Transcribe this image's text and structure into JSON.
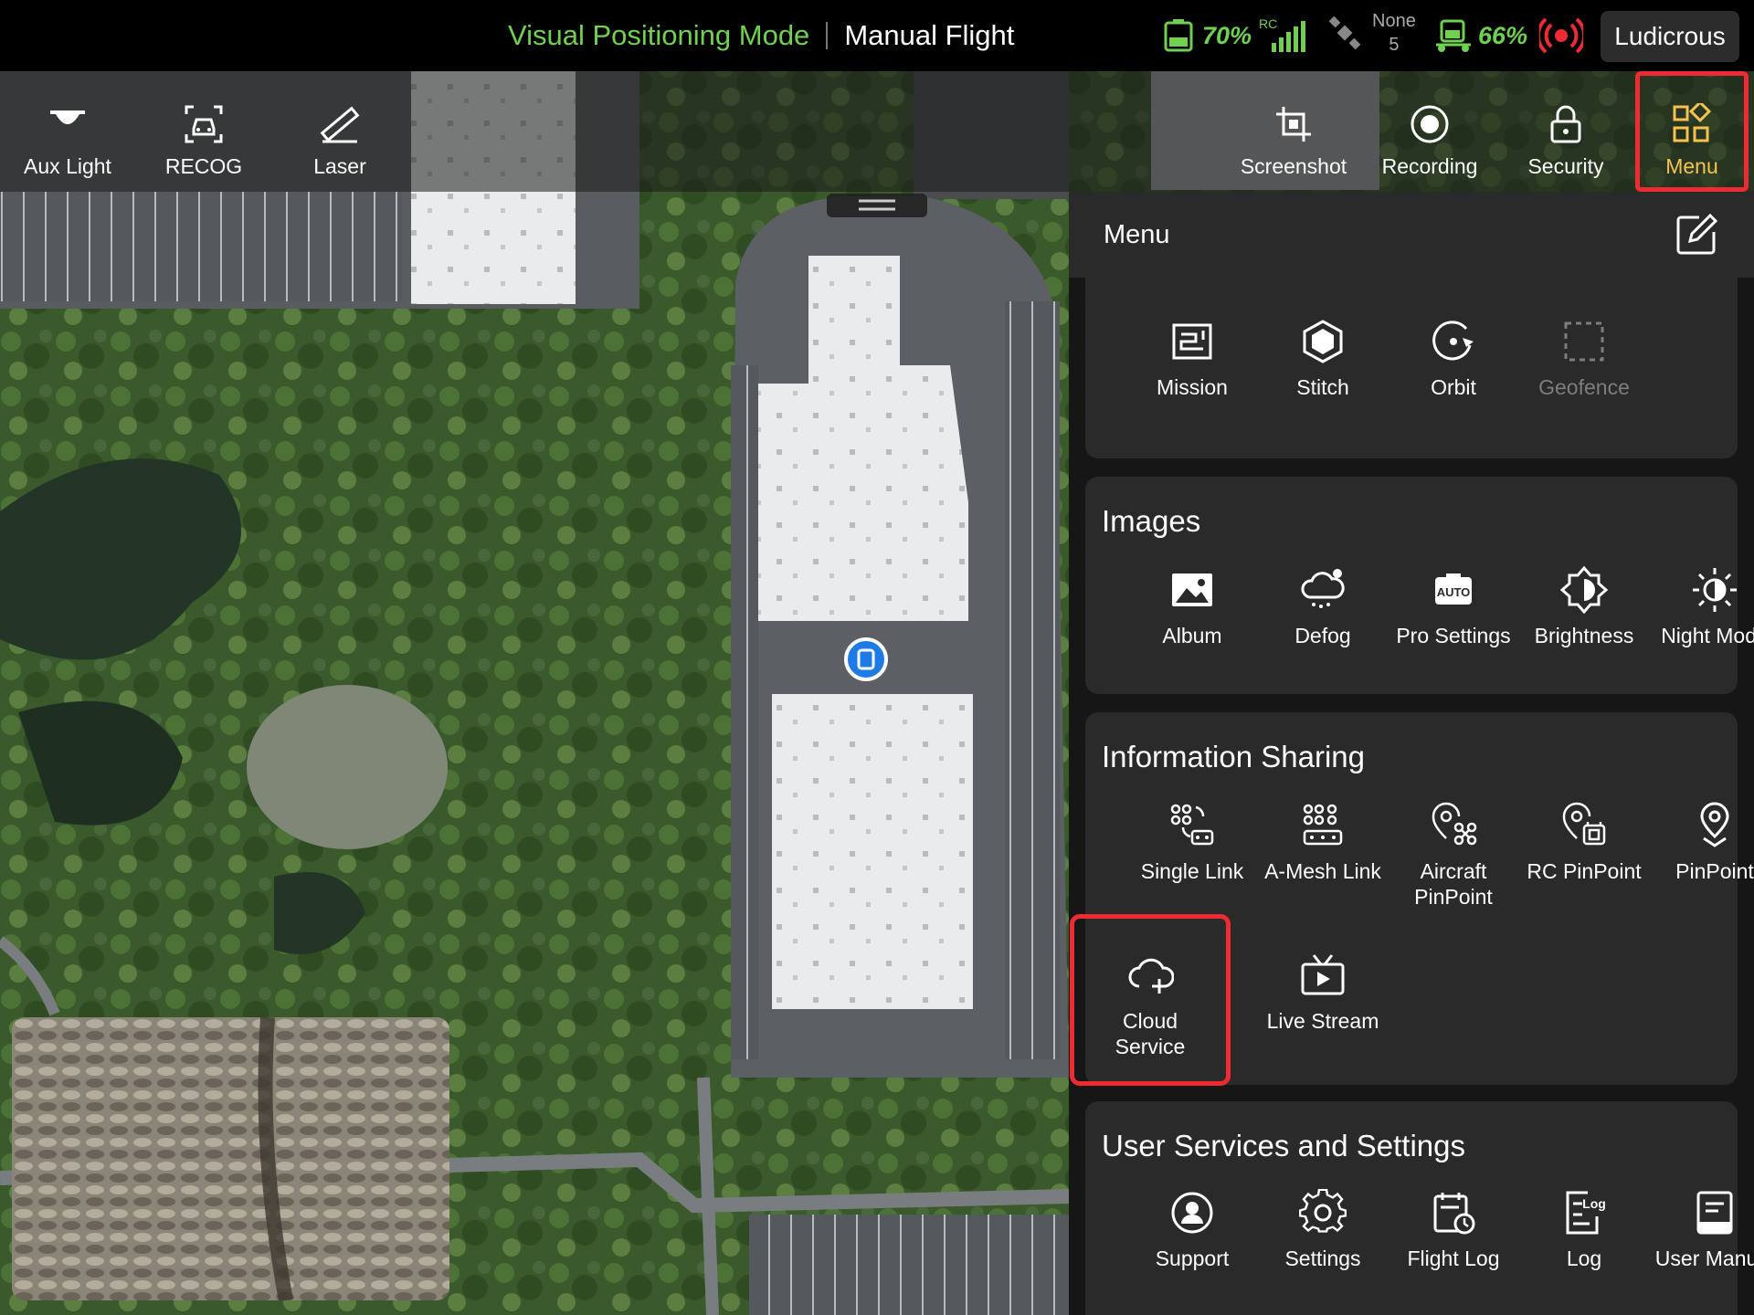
{
  "status_bar": {
    "positioning_mode": "Visual Positioning Mode",
    "flight_mode": "Manual Flight",
    "rc_battery_pct": "70%",
    "rc_label": "RC",
    "gnss_status": "None",
    "satellite_count": "5",
    "aircraft_battery_pct": "66%",
    "speed_mode": "Ludicrous",
    "colors": {
      "accent_green": "#6fd14f",
      "alert_red": "#ee2b33",
      "menu_active": "#f5c24b"
    }
  },
  "toolbar": {
    "left": [
      {
        "label": "Aux Light",
        "icon": "aux-light-icon"
      },
      {
        "label": "RECOG",
        "icon": "recog-car-icon"
      },
      {
        "label": "Laser",
        "icon": "laser-ruler-icon"
      }
    ],
    "right": [
      {
        "label": "Screenshot",
        "icon": "screenshot-crop-icon"
      },
      {
        "label": "Recording",
        "icon": "record-icon"
      },
      {
        "label": "Security",
        "icon": "lock-icon"
      },
      {
        "label": "Menu",
        "icon": "grid-menu-icon",
        "active": true
      }
    ]
  },
  "panel": {
    "title": "Menu",
    "edit_icon": "edit-icon",
    "sections": [
      {
        "title": "",
        "items": [
          {
            "label": "Mission",
            "icon": "mission-icon"
          },
          {
            "label": "Stitch",
            "icon": "stitch-icon"
          },
          {
            "label": "Orbit",
            "icon": "orbit-icon"
          },
          {
            "label": "Geofence",
            "icon": "geofence-icon",
            "disabled": true
          }
        ]
      },
      {
        "title": "Images",
        "items": [
          {
            "label": "Album",
            "icon": "album-icon"
          },
          {
            "label": "Defog",
            "icon": "defog-icon"
          },
          {
            "label": "Pro Settings",
            "icon": "auto-icon"
          },
          {
            "label": "Brightness",
            "icon": "brightness-icon"
          },
          {
            "label": "Night Mode",
            "icon": "night-mode-icon"
          }
        ]
      },
      {
        "title": "Information Sharing",
        "items": [
          {
            "label": "Single Link",
            "icon": "single-link-icon"
          },
          {
            "label": "A-Mesh Link",
            "icon": "mesh-link-icon"
          },
          {
            "label": "Aircraft\nPinPoint",
            "label_line1": "Aircraft",
            "label_line2": "PinPoint",
            "icon": "aircraft-pinpoint-icon"
          },
          {
            "label": "RC PinPoint",
            "icon": "rc-pinpoint-icon"
          },
          {
            "label": "PinPoint",
            "icon": "pinpoint-icon"
          },
          {
            "label_line1": "Cloud",
            "label_line2": "Service",
            "icon": "cloud-service-icon",
            "highlighted": true
          },
          {
            "label": "Live Stream",
            "icon": "live-stream-icon"
          }
        ]
      },
      {
        "title": "User Services and Settings",
        "items": [
          {
            "label": "Support",
            "icon": "support-icon"
          },
          {
            "label": "Settings",
            "icon": "settings-gear-icon"
          },
          {
            "label": "Flight Log",
            "icon": "flight-log-icon"
          },
          {
            "label": "Log",
            "icon": "log-icon"
          },
          {
            "label": "User Manual",
            "icon": "user-manual-icon"
          }
        ]
      }
    ]
  }
}
